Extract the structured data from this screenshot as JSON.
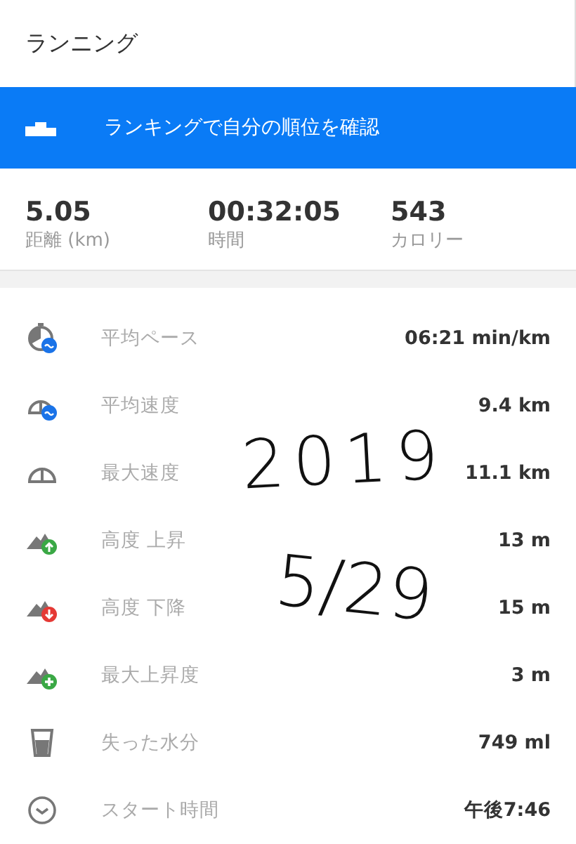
{
  "header": {
    "title": "ランニング"
  },
  "banner": {
    "label": "ランキングで自分の順位を確認"
  },
  "summary": [
    {
      "value": "5.05",
      "label": "距離 (km)"
    },
    {
      "value": "00:32:05",
      "label": "時間"
    },
    {
      "value": "543",
      "label": "カロリー"
    }
  ],
  "stats": [
    {
      "kind": "pace",
      "label": "平均ペース",
      "value": "06:21 min/km"
    },
    {
      "kind": "avg-speed",
      "label": "平均速度",
      "value": "9.4 km"
    },
    {
      "kind": "max-speed",
      "label": "最大速度",
      "value": "11.1 km"
    },
    {
      "kind": "ascent",
      "label": "高度 上昇",
      "value": "13 m"
    },
    {
      "kind": "descent",
      "label": "高度 下降",
      "value": "15 m"
    },
    {
      "kind": "max-climb",
      "label": "最大上昇度",
      "value": "3 m"
    },
    {
      "kind": "water",
      "label": "失った水分",
      "value": "749 ml"
    },
    {
      "kind": "clock",
      "label": "スタート時間",
      "value": "午後7:46"
    }
  ],
  "handwriting": [
    {
      "text": "2019"
    },
    {
      "text": "5/29"
    }
  ]
}
